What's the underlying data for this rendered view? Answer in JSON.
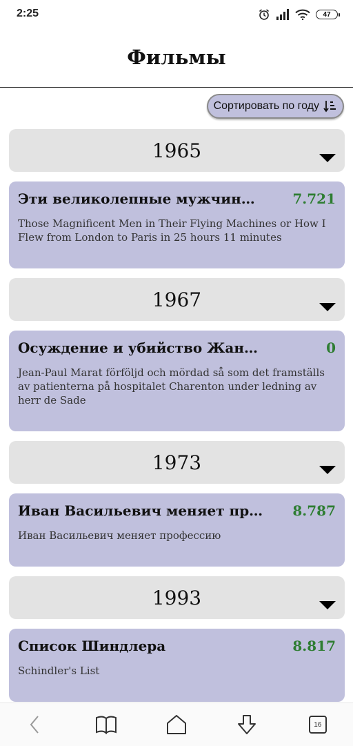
{
  "status_bar": {
    "time": "2:25",
    "battery": "47"
  },
  "header": {
    "title": "Фильмы"
  },
  "sort": {
    "label": "Сортировать по году"
  },
  "groups": [
    {
      "year": "1965",
      "films": [
        {
          "title": "Эти великолепные мужчин…",
          "rating": "7.721",
          "original": "Those Magnificent Men in Their Flying Machines or How I Flew from London to Paris in 25 hours 11 minutes"
        }
      ]
    },
    {
      "year": "1967",
      "films": [
        {
          "title": "Осуждение и убийство Жан…",
          "rating": "0",
          "original": "Jean-Paul Marat förföljd och mördad så som det framställs av patienterna på hospitalet Charenton under ledning av herr de Sade"
        }
      ]
    },
    {
      "year": "1973",
      "films": [
        {
          "title": "Иван Васильевич меняет пр…",
          "rating": "8.787",
          "original": "Иван Васильевич меняет профессию"
        }
      ]
    },
    {
      "year": "1993",
      "films": [
        {
          "title": "Список Шиндлера",
          "rating": "8.817",
          "original": "Schindler's List"
        }
      ]
    }
  ],
  "nav": {
    "tabs_count": "16"
  },
  "colors": {
    "card": "#c0c0dd",
    "year_header": "#e3e3e3",
    "rating": "#2e7d32"
  },
  "icons": {
    "sort": "sort-ascending-icon",
    "back": "back-icon",
    "bookmarks": "book-icon",
    "home": "home-icon",
    "download": "download-icon",
    "tabs": "tabs-icon"
  }
}
